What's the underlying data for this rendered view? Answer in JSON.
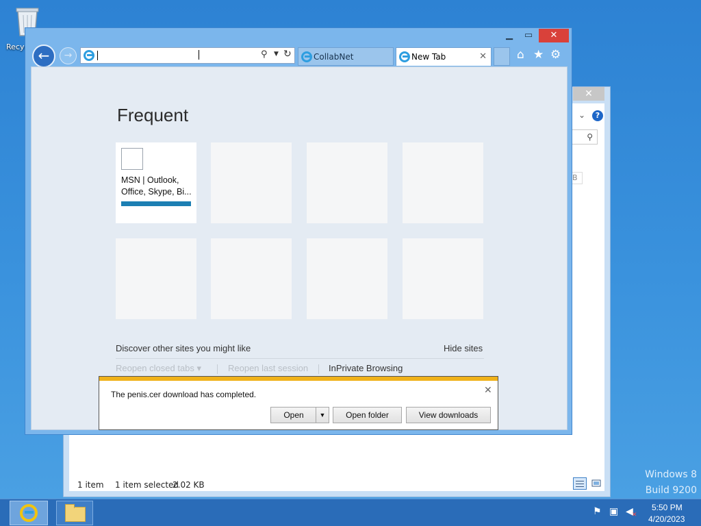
{
  "desktop": {
    "recycle_bin_label": "Recyc",
    "watermark_line1": "Windows 8",
    "watermark_line2": "Build 9200"
  },
  "explorer": {
    "close_glyph": "✕",
    "kb_fragment": "B",
    "status_items": "1 item",
    "status_selected": "1 item selected",
    "status_size": "2.02 KB"
  },
  "browser": {
    "address": {
      "value": "",
      "placeholder": ""
    },
    "tabs": [
      {
        "label": "CollabNet",
        "active": false
      },
      {
        "label": "New Tab",
        "active": true
      }
    ],
    "new_tab_page": {
      "heading": "Frequent",
      "tiles": [
        {
          "title_line1": "MSN | Outlook,",
          "title_line2": "Office, Skype, Bi..."
        }
      ],
      "discover_text": "Discover other sites you might like",
      "hide_sites": "Hide sites",
      "reopen_closed_tabs": "Reopen closed tabs",
      "reopen_last_session": "Reopen last session",
      "inprivate": "InPrivate Browsing"
    },
    "notification": {
      "message": "The penis.cer download has completed.",
      "open_label": "Open",
      "open_folder_label": "Open folder",
      "view_downloads_label": "View downloads"
    }
  },
  "taskbar": {
    "time": "5:50 PM",
    "date": "4/20/2023"
  },
  "colors": {
    "desktop": "#3a92dd",
    "close_button": "#d9413a",
    "notification_stripe": "#f0b21a",
    "tile_bar": "#1c7fb3"
  }
}
